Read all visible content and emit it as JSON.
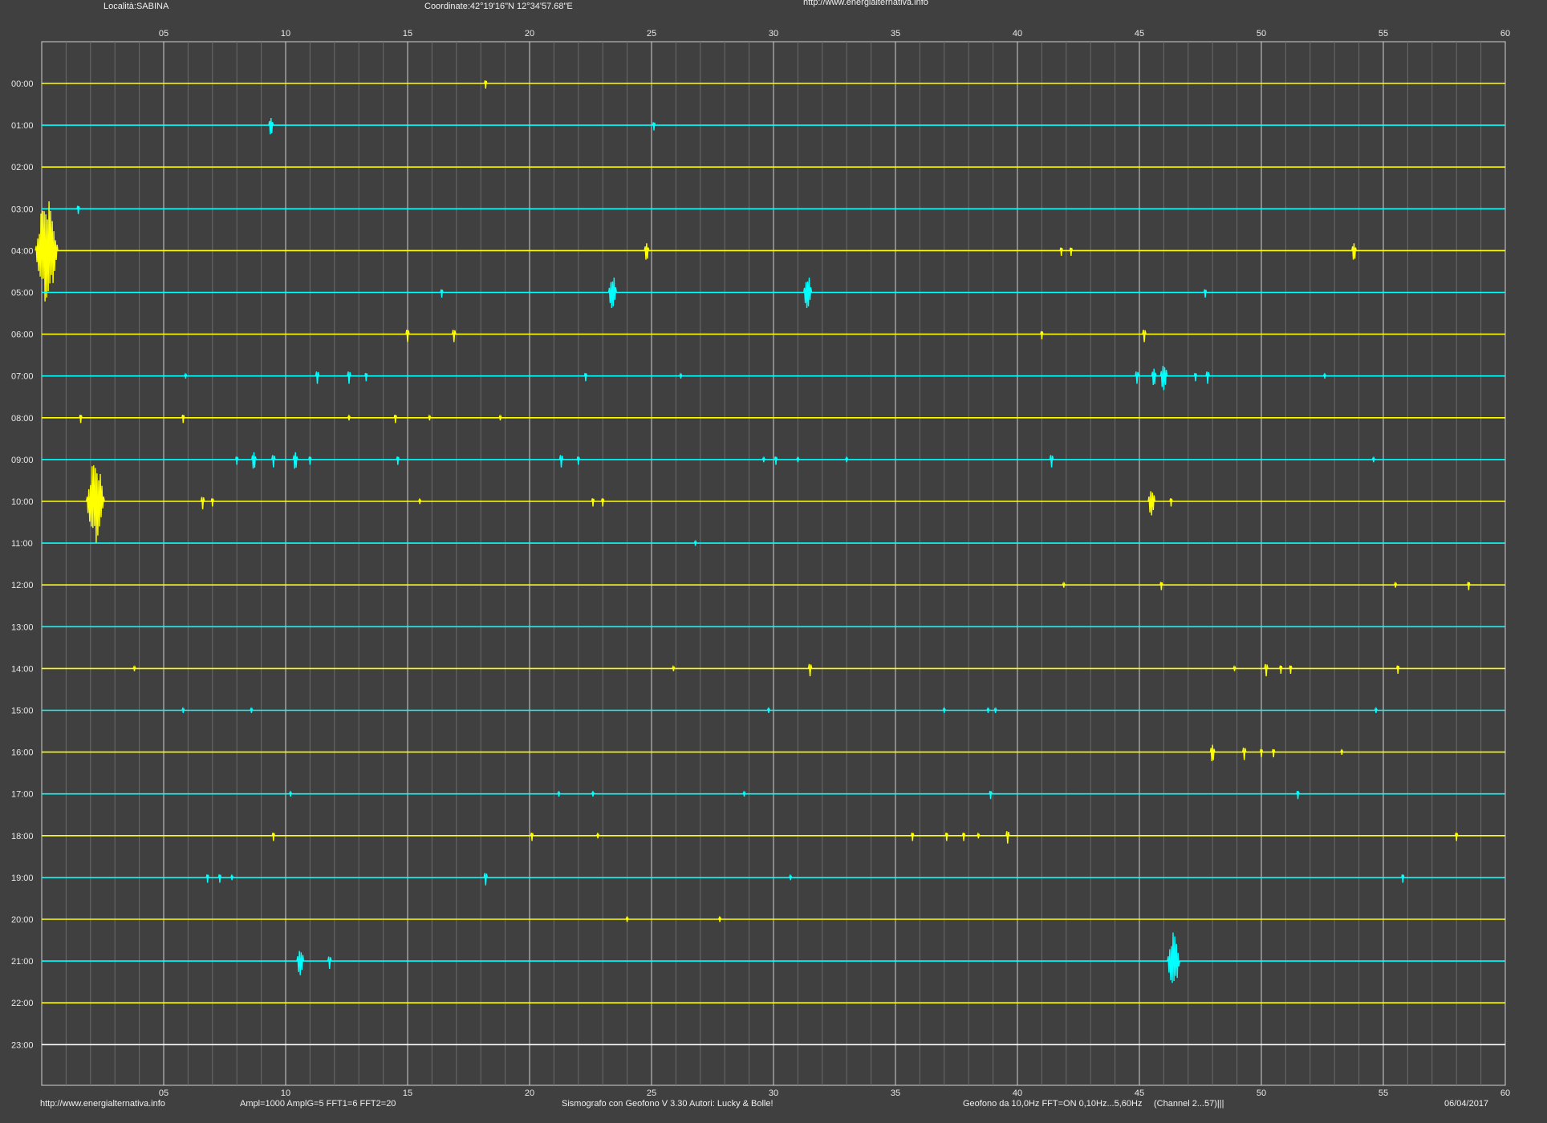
{
  "header": {
    "location": "Località:SABINA",
    "coordinates": "Coordinate:42°19'16\"N  12°34'57.68\"E",
    "url": "http://www.energialternativa.info"
  },
  "footer": {
    "url": "http://www.energialternativa.info",
    "amplification": "Ampl=1000 AmplG=5 FFT1=6 FFT2=20",
    "software": "Sismografo con Geofono V 3.30  Autori: Lucky & Bolle!",
    "geophone": "Geofono da 10,0Hz FFT=ON 0,10Hz...5,60Hz",
    "channel": "(Channel 2...57)|||",
    "date": "06/04/2017"
  },
  "colors": {
    "background": "#404040",
    "grid_major": "#d0d0d0",
    "grid_minor": "#6a6a6a",
    "trace_even": "#ffff00",
    "trace_odd": "#00ffff",
    "trace_idle": "#ffffff"
  },
  "chart_data": {
    "type": "line",
    "title": "",
    "xlabel": "",
    "ylabel": "",
    "xlim": [
      0,
      60
    ],
    "x_ticks": [
      "05",
      "10",
      "15",
      "20",
      "25",
      "30",
      "35",
      "40",
      "45",
      "50",
      "55",
      "60"
    ],
    "x_tick_values": [
      5,
      10,
      15,
      20,
      25,
      30,
      35,
      40,
      45,
      50,
      55,
      60
    ],
    "grid": true,
    "series": [
      {
        "label": "00:00",
        "events": [
          {
            "x": 18.2,
            "a": 0.1
          }
        ]
      },
      {
        "label": "01:00",
        "events": [
          {
            "x": 9.4,
            "a": 0.2
          },
          {
            "x": 25.1,
            "a": 0.1
          }
        ]
      },
      {
        "label": "02:00",
        "events": []
      },
      {
        "label": "03:00",
        "events": [
          {
            "x": 1.5,
            "a": 0.1
          }
        ]
      },
      {
        "label": "04:00",
        "events": [
          {
            "x": 0.2,
            "a": 1.0
          },
          {
            "x": 24.8,
            "a": 0.2
          },
          {
            "x": 41.8,
            "a": 0.1
          },
          {
            "x": 42.2,
            "a": 0.1
          },
          {
            "x": 53.8,
            "a": 0.2
          }
        ]
      },
      {
        "label": "05:00",
        "events": [
          {
            "x": 16.4,
            "a": 0.1
          },
          {
            "x": 23.4,
            "a": 0.35
          },
          {
            "x": 31.4,
            "a": 0.35
          },
          {
            "x": 47.7,
            "a": 0.1
          }
        ]
      },
      {
        "label": "06:00",
        "events": [
          {
            "x": 15.0,
            "a": 0.15
          },
          {
            "x": 16.9,
            "a": 0.15
          },
          {
            "x": 41.0,
            "a": 0.1
          },
          {
            "x": 45.2,
            "a": 0.15
          }
        ]
      },
      {
        "label": "07:00",
        "events": [
          {
            "x": 5.9,
            "a": 0.05
          },
          {
            "x": 11.3,
            "a": 0.15
          },
          {
            "x": 12.6,
            "a": 0.15
          },
          {
            "x": 13.3,
            "a": 0.1
          },
          {
            "x": 22.3,
            "a": 0.1
          },
          {
            "x": 26.2,
            "a": 0.05
          },
          {
            "x": 44.9,
            "a": 0.15
          },
          {
            "x": 45.6,
            "a": 0.2
          },
          {
            "x": 46.0,
            "a": 0.3
          },
          {
            "x": 47.3,
            "a": 0.1
          },
          {
            "x": 47.8,
            "a": 0.15
          },
          {
            "x": 52.6,
            "a": 0.05
          }
        ]
      },
      {
        "label": "08:00",
        "events": [
          {
            "x": 1.6,
            "a": 0.1
          },
          {
            "x": 5.8,
            "a": 0.1
          },
          {
            "x": 12.6,
            "a": 0.05
          },
          {
            "x": 14.5,
            "a": 0.1
          },
          {
            "x": 15.9,
            "a": 0.05
          },
          {
            "x": 18.8,
            "a": 0.05
          }
        ]
      },
      {
        "label": "09:00",
        "events": [
          {
            "x": 8.0,
            "a": 0.1
          },
          {
            "x": 8.7,
            "a": 0.2
          },
          {
            "x": 9.5,
            "a": 0.15
          },
          {
            "x": 10.4,
            "a": 0.2
          },
          {
            "x": 11.0,
            "a": 0.1
          },
          {
            "x": 14.6,
            "a": 0.1
          },
          {
            "x": 21.3,
            "a": 0.15
          },
          {
            "x": 22.0,
            "a": 0.1
          },
          {
            "x": 29.6,
            "a": 0.05
          },
          {
            "x": 30.1,
            "a": 0.1
          },
          {
            "x": 31.0,
            "a": 0.05
          },
          {
            "x": 33.0,
            "a": 0.05
          },
          {
            "x": 41.4,
            "a": 0.15
          },
          {
            "x": 54.6,
            "a": 0.05
          }
        ]
      },
      {
        "label": "10:00",
        "events": [
          {
            "x": 2.2,
            "a": 0.8
          },
          {
            "x": 6.6,
            "a": 0.15
          },
          {
            "x": 7.0,
            "a": 0.1
          },
          {
            "x": 15.5,
            "a": 0.05
          },
          {
            "x": 22.6,
            "a": 0.1
          },
          {
            "x": 23.0,
            "a": 0.1
          },
          {
            "x": 45.5,
            "a": 0.3
          },
          {
            "x": 46.3,
            "a": 0.1
          }
        ]
      },
      {
        "label": "11:00",
        "events": [
          {
            "x": 26.8,
            "a": 0.05
          }
        ]
      },
      {
        "label": "12:00",
        "events": [
          {
            "x": 41.9,
            "a": 0.05
          },
          {
            "x": 45.9,
            "a": 0.1
          },
          {
            "x": 55.5,
            "a": 0.05
          },
          {
            "x": 58.5,
            "a": 0.1
          }
        ]
      },
      {
        "label": "13:00",
        "events": []
      },
      {
        "label": "14:00",
        "events": [
          {
            "x": 3.8,
            "a": 0.05
          },
          {
            "x": 25.9,
            "a": 0.05
          },
          {
            "x": 31.5,
            "a": 0.15
          },
          {
            "x": 48.9,
            "a": 0.05
          },
          {
            "x": 50.2,
            "a": 0.15
          },
          {
            "x": 50.8,
            "a": 0.1
          },
          {
            "x": 51.2,
            "a": 0.1
          },
          {
            "x": 55.6,
            "a": 0.1
          }
        ]
      },
      {
        "label": "15:00",
        "events": [
          {
            "x": 5.8,
            "a": 0.05
          },
          {
            "x": 8.6,
            "a": 0.05
          },
          {
            "x": 29.8,
            "a": 0.05
          },
          {
            "x": 37.0,
            "a": 0.05
          },
          {
            "x": 38.8,
            "a": 0.05
          },
          {
            "x": 39.1,
            "a": 0.05
          },
          {
            "x": 54.7,
            "a": 0.05
          }
        ]
      },
      {
        "label": "16:00",
        "events": [
          {
            "x": 48.0,
            "a": 0.2
          },
          {
            "x": 49.3,
            "a": 0.15
          },
          {
            "x": 50.0,
            "a": 0.1
          },
          {
            "x": 50.5,
            "a": 0.1
          },
          {
            "x": 53.3,
            "a": 0.05
          }
        ]
      },
      {
        "label": "17:00",
        "events": [
          {
            "x": 10.2,
            "a": 0.05
          },
          {
            "x": 21.2,
            "a": 0.05
          },
          {
            "x": 22.6,
            "a": 0.05
          },
          {
            "x": 28.8,
            "a": 0.05
          },
          {
            "x": 38.9,
            "a": 0.1
          },
          {
            "x": 51.5,
            "a": 0.1
          }
        ]
      },
      {
        "label": "18:00",
        "events": [
          {
            "x": 9.5,
            "a": 0.1
          },
          {
            "x": 20.1,
            "a": 0.1
          },
          {
            "x": 22.8,
            "a": 0.05
          },
          {
            "x": 35.7,
            "a": 0.1
          },
          {
            "x": 37.1,
            "a": 0.1
          },
          {
            "x": 37.8,
            "a": 0.1
          },
          {
            "x": 38.4,
            "a": 0.05
          },
          {
            "x": 39.6,
            "a": 0.15
          },
          {
            "x": 58.0,
            "a": 0.1
          }
        ]
      },
      {
        "label": "19:00",
        "events": [
          {
            "x": 6.8,
            "a": 0.1
          },
          {
            "x": 7.3,
            "a": 0.1
          },
          {
            "x": 7.8,
            "a": 0.05
          },
          {
            "x": 18.2,
            "a": 0.15
          },
          {
            "x": 30.7,
            "a": 0.05
          },
          {
            "x": 55.8,
            "a": 0.1
          }
        ]
      },
      {
        "label": "20:00",
        "events": [
          {
            "x": 24.0,
            "a": 0.05
          },
          {
            "x": 27.8,
            "a": 0.05
          }
        ]
      },
      {
        "label": "21:00",
        "events": [
          {
            "x": 10.6,
            "a": 0.3
          },
          {
            "x": 11.8,
            "a": 0.15
          },
          {
            "x": 46.4,
            "a": 0.55
          }
        ]
      },
      {
        "label": "22:00",
        "events": []
      },
      {
        "label": "23:00",
        "events": []
      }
    ]
  }
}
